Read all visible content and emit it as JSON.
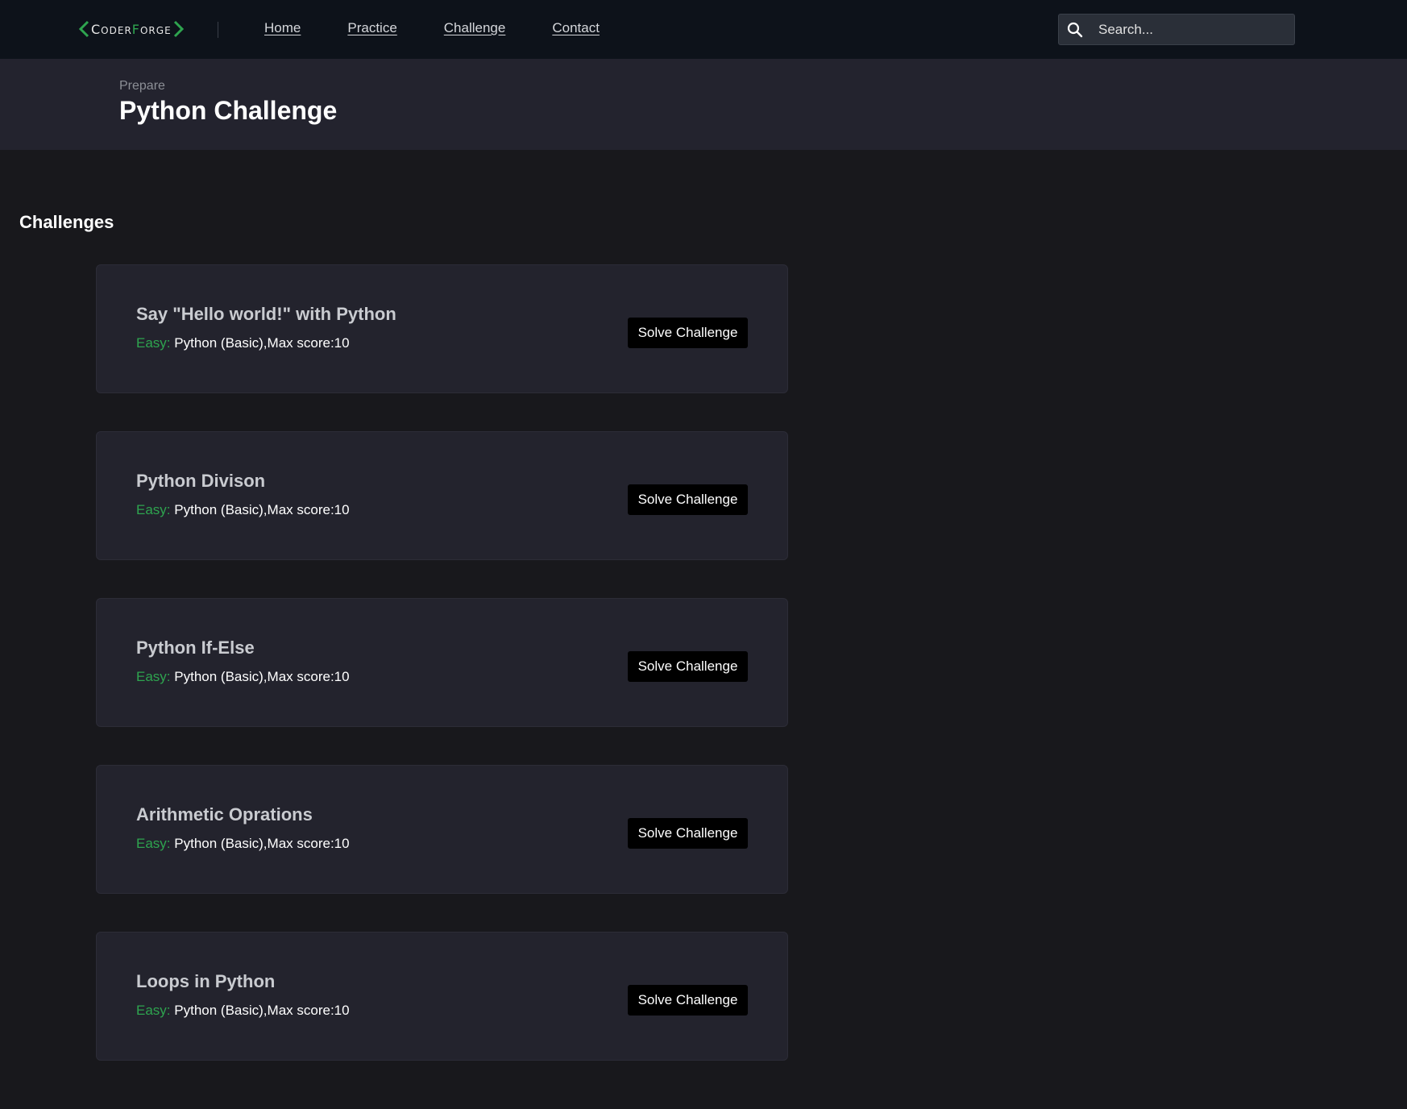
{
  "navbar": {
    "logo": {
      "first_cap": "C",
      "first_rest": "ODER",
      "second_cap": "F",
      "second_rest": "ORGE",
      "accent_color": "#2ea44f"
    },
    "links": [
      "Home",
      "Practice",
      "Challenge",
      "Contact"
    ],
    "search": {
      "placeholder": "Search..."
    }
  },
  "header": {
    "breadcrumb": "Prepare",
    "title": "Python Challenge"
  },
  "challenges": {
    "section_title": "Challenges",
    "items": [
      {
        "title": "Say \"Hello world!\" with Python",
        "difficulty": "Easy:",
        "meta": "Python (Basic),Max score:10",
        "button": "Solve Challenge"
      },
      {
        "title": "Python Divison",
        "difficulty": "Easy:",
        "meta": "Python (Basic),Max score:10",
        "button": "Solve Challenge"
      },
      {
        "title": "Python If-Else",
        "difficulty": "Easy:",
        "meta": "Python (Basic),Max score:10",
        "button": "Solve Challenge"
      },
      {
        "title": "Arithmetic Oprations",
        "difficulty": "Easy:",
        "meta": "Python (Basic),Max score:10",
        "button": "Solve Challenge"
      },
      {
        "title": "Loops in Python",
        "difficulty": "Easy:",
        "meta": "Python (Basic),Max score:10",
        "button": "Solve Challenge"
      }
    ]
  },
  "colors": {
    "navbar_bg": "#0d121a",
    "header_bg": "#23232e",
    "page_bg": "#18181c",
    "card_bg": "#23232d",
    "easy_green": "#2ea44f"
  },
  "icons": {
    "logo_left": "chevron-left-icon",
    "logo_right": "chevron-right-icon",
    "search": "search-icon"
  }
}
